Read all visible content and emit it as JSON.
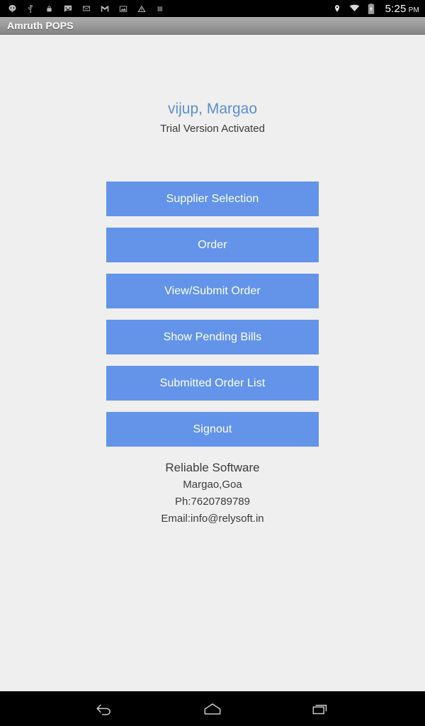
{
  "status_bar": {
    "left_icons": [
      {
        "name": "hangouts-icon"
      },
      {
        "name": "usb-icon"
      },
      {
        "name": "lock-icon"
      },
      {
        "name": "messaging-icon"
      },
      {
        "name": "email-icon"
      },
      {
        "name": "gmail-icon"
      },
      {
        "name": "screenshot-icon"
      },
      {
        "name": "warning-icon"
      },
      {
        "name": "vpn-icon"
      }
    ],
    "right_icons": [
      {
        "name": "location-icon"
      },
      {
        "name": "wifi-icon"
      },
      {
        "name": "battery-charging-icon"
      }
    ],
    "time": "5:25",
    "meridiem": "PM"
  },
  "action_bar": {
    "title": "Amruth POPS"
  },
  "main": {
    "store_name": "vijup, Margao",
    "trial_status": "Trial Version Activated",
    "buttons": [
      {
        "label": "Supplier Selection",
        "name": "supplier-selection-button"
      },
      {
        "label": "Order",
        "name": "order-button"
      },
      {
        "label": "View/Submit Order",
        "name": "view-submit-order-button"
      },
      {
        "label": "Show Pending Bills",
        "name": "show-pending-bills-button"
      },
      {
        "label": "Submitted Order List",
        "name": "submitted-order-list-button"
      },
      {
        "label": "Signout",
        "name": "signout-button"
      }
    ]
  },
  "footer": {
    "company": "Reliable Software",
    "address": "Margao,Goa",
    "phone": "Ph:7620789789",
    "email": "Email:info@relysoft.in"
  },
  "nav_bar": {
    "back_label": "Back",
    "home_label": "Home",
    "recents_label": "Recent apps"
  },
  "colors": {
    "button_blue": "#6394ea",
    "heading_blue": "#5b8ecb",
    "background": "#efefef",
    "action_bar_gray": "#9d9d9d"
  }
}
